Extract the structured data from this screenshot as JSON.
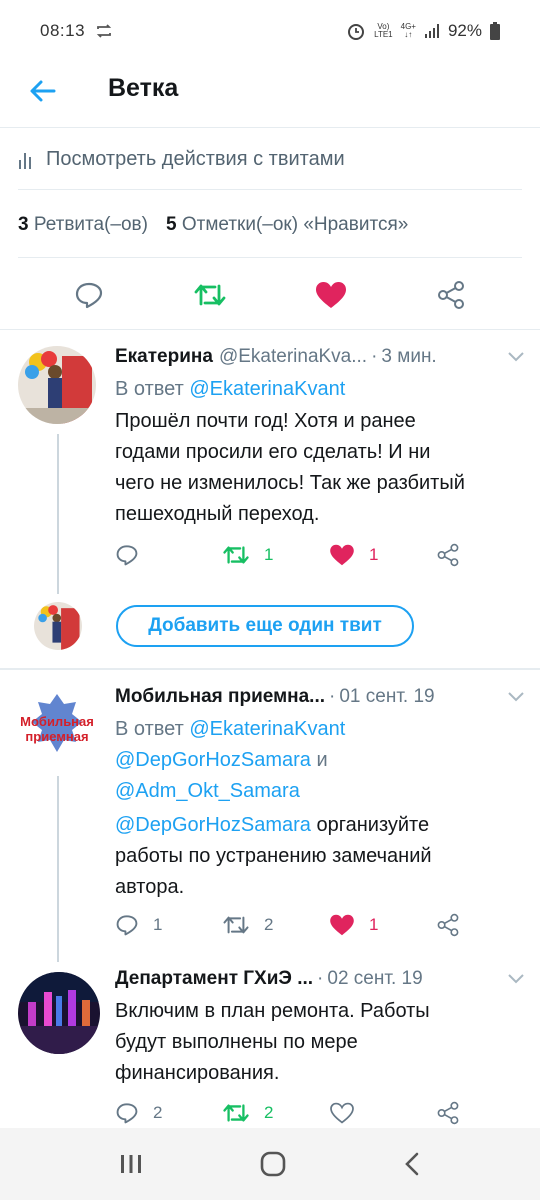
{
  "status_bar": {
    "time": "08:13",
    "network_top": "Vo)",
    "network_bottom": "LTE1",
    "net_type_top": "4G+",
    "battery": "92%"
  },
  "header": {
    "title": "Ветка"
  },
  "activity": {
    "label": "Посмотреть действия с твитами"
  },
  "counts": {
    "retweets_num": "3",
    "retweets_label": "Ретвита(–ов)",
    "likes_num": "5",
    "likes_label": "Отметки(–ок) «Нравится»"
  },
  "tweets": [
    {
      "name": "Екатерина",
      "handle": "@EkaterinaKva...",
      "dot": "·",
      "time": "3 мин.",
      "reply_prefix": "В ответ",
      "reply_mentions": "@EkaterinaKvant",
      "body_lines": [
        "Прошёл почти год! Хотя и ранее",
        "годами просили его сделать! И ни",
        "чего не изменилось! Так же разбитый",
        "пешеходный переход."
      ],
      "replies": "",
      "retweets": "1",
      "likes": "1"
    },
    {
      "name": "Мобильная приемна...",
      "handle": "",
      "dot": "·",
      "time": "01 сент. 19",
      "reply_prefix": "В ответ",
      "reply_line1": "@EkaterinaKvant",
      "reply_line2a": "@DepGorHozSamara",
      "reply_and": "и",
      "reply_line3": "@Adm_Okt_Samara",
      "body_mention": "@DepGorHozSamara",
      "body_line1_rest": "организуйте",
      "body_line2": "работы по устранению замечаний",
      "body_line3": "автора.",
      "avatar_text_top": "Мобильная",
      "avatar_text_bottom": "приемная",
      "replies": "1",
      "retweets": "2",
      "likes": "1"
    },
    {
      "name": "Департамент ГХиЭ ...",
      "handle": "",
      "dot": "·",
      "time": "02 сент. 19",
      "body_lines": [
        "Включим в план ремонта. Работы",
        "будут выполнены по мере",
        "финансирования."
      ],
      "replies": "2",
      "retweets": "2",
      "likes": ""
    }
  ],
  "add_tweet_button": "Добавить еще один твит",
  "colors": {
    "accent": "#1da1f2",
    "retweet": "#17bf63",
    "like": "#e0245e",
    "muted": "#657786"
  }
}
